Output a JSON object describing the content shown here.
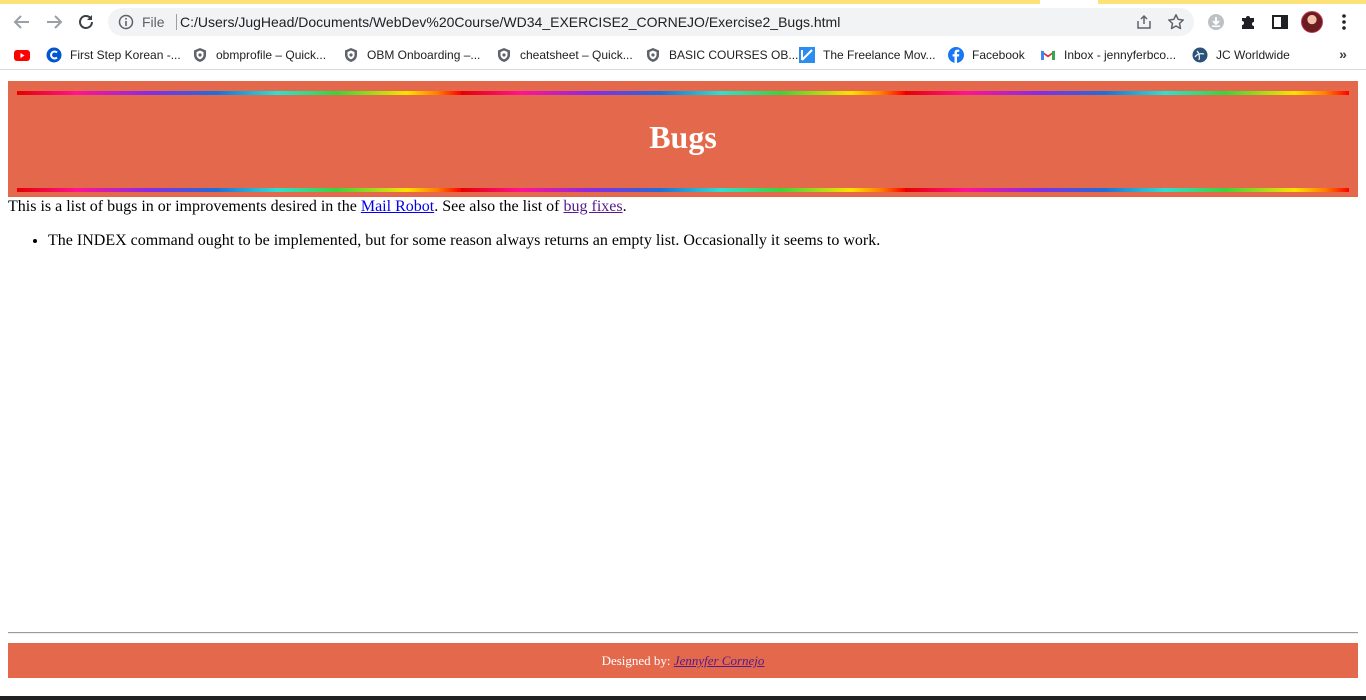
{
  "browser": {
    "address": {
      "scheme_label": "File",
      "url": "C:/Users/JugHead/Documents/WebDev%20Course/WD34_EXERCISE2_CORNEJO/Exercise2_Bugs.html"
    },
    "bookmarks": [
      {
        "label": "",
        "icon": "youtube-icon"
      },
      {
        "label": "First Step Korean -...",
        "icon": "coursera-icon"
      },
      {
        "label": "obmprofile – Quick...",
        "icon": "shield-icon"
      },
      {
        "label": "OBM Onboarding –...",
        "icon": "shield-icon"
      },
      {
        "label": "cheatsheet – Quick...",
        "icon": "shield-icon"
      },
      {
        "label": "BASIC COURSES OB...",
        "icon": "shield-icon"
      },
      {
        "label": "The Freelance Mov...",
        "icon": "k-icon"
      },
      {
        "label": "Facebook",
        "icon": "facebook-icon"
      },
      {
        "label": "Inbox - jennyferbco...",
        "icon": "gmail-icon"
      },
      {
        "label": "JC Worldwide",
        "icon": "globe-icon"
      }
    ],
    "more_label": "»"
  },
  "page": {
    "title": "Bugs",
    "intro": {
      "before": "This is a list of bugs in or improvements desired in the ",
      "link1": "Mail Robot",
      "middle": ". See also the list of ",
      "link2": "bug fixes",
      "after": "."
    },
    "bugs": [
      "The INDEX command ought to be implemented, but for some reason always returns an empty list. Occasionally it seems to work."
    ],
    "footer": {
      "prefix": "Designed by: ",
      "author": "Jennyfer Cornejo"
    }
  },
  "colors": {
    "banner": "#e4694c",
    "link": "#0000ee",
    "visited_link": "#551a8b"
  }
}
